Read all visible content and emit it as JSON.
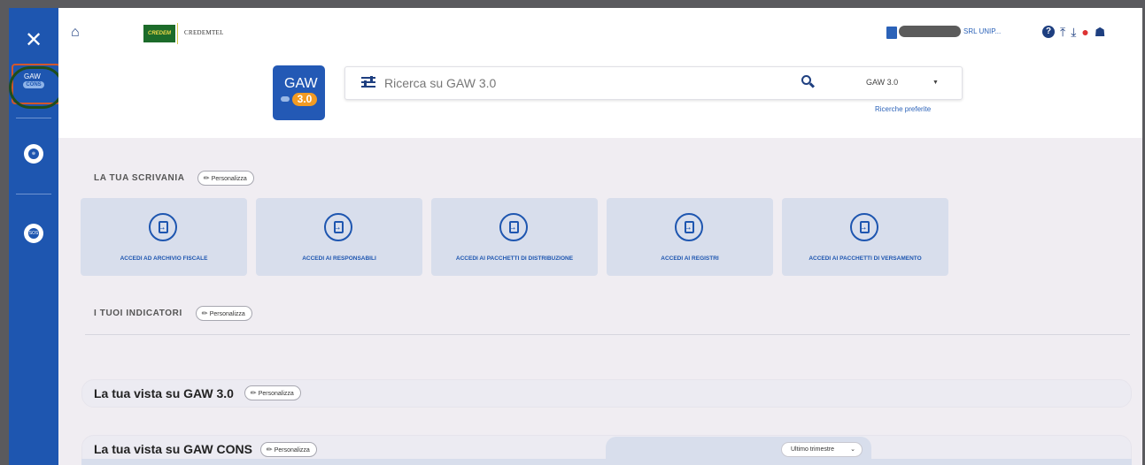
{
  "sidebar": {
    "close_icon": "close-icon",
    "gaw_cons_label": "GAW",
    "gaw_cons_pill": "CONS",
    "items": [
      {
        "icon": "globe-icon",
        "badge": ""
      },
      {
        "icon": "sos-chat-icon",
        "badge": "SOS"
      }
    ]
  },
  "header": {
    "home_icon": "home-icon",
    "logo_credem": "CREDEM",
    "logo_credemtel": "CREDEMTEL",
    "gaw_word": "GAW",
    "gaw_version": "3.0",
    "search": {
      "placeholder": "Ricerca su GAW 3.0",
      "scope_value": "GAW 3.0",
      "saved_searches_link": "Ricerche preferite"
    },
    "company_name": "SRL UNIP...",
    "icons": [
      "help-icon",
      "upload-icon",
      "download-icon",
      "notifications-icon",
      "user-icon"
    ]
  },
  "desk": {
    "title": "LA TUA SCRIVANIA",
    "customize_label": "Personalizza",
    "cards": [
      {
        "label": "ACCEDI AD ARCHIVIO FISCALE"
      },
      {
        "label": "ACCEDI AI RESPONSABILI"
      },
      {
        "label": "ACCEDI AI PACCHETTI DI DISTRIBUZIONE"
      },
      {
        "label": "ACCEDI AI REGISTRI"
      },
      {
        "label": "ACCEDI AI PACCHETTI DI VERSAMENTO"
      }
    ]
  },
  "indicators": {
    "title": "I TUOI INDICATORI",
    "customize_label": "Personalizza"
  },
  "view_gaw30": {
    "title": "La tua vista su GAW 3.0",
    "customize_label": "Personalizza"
  },
  "view_gawcons": {
    "title": "La tua vista su GAW CONS",
    "customize_label": "Personalizza",
    "period_select": "Ultimo trimestre"
  },
  "colors": {
    "sidebar": "#1e56b0",
    "accent": "#2b62b8",
    "gaw_orange": "#f39b23",
    "card_bg": "#d8deec"
  }
}
